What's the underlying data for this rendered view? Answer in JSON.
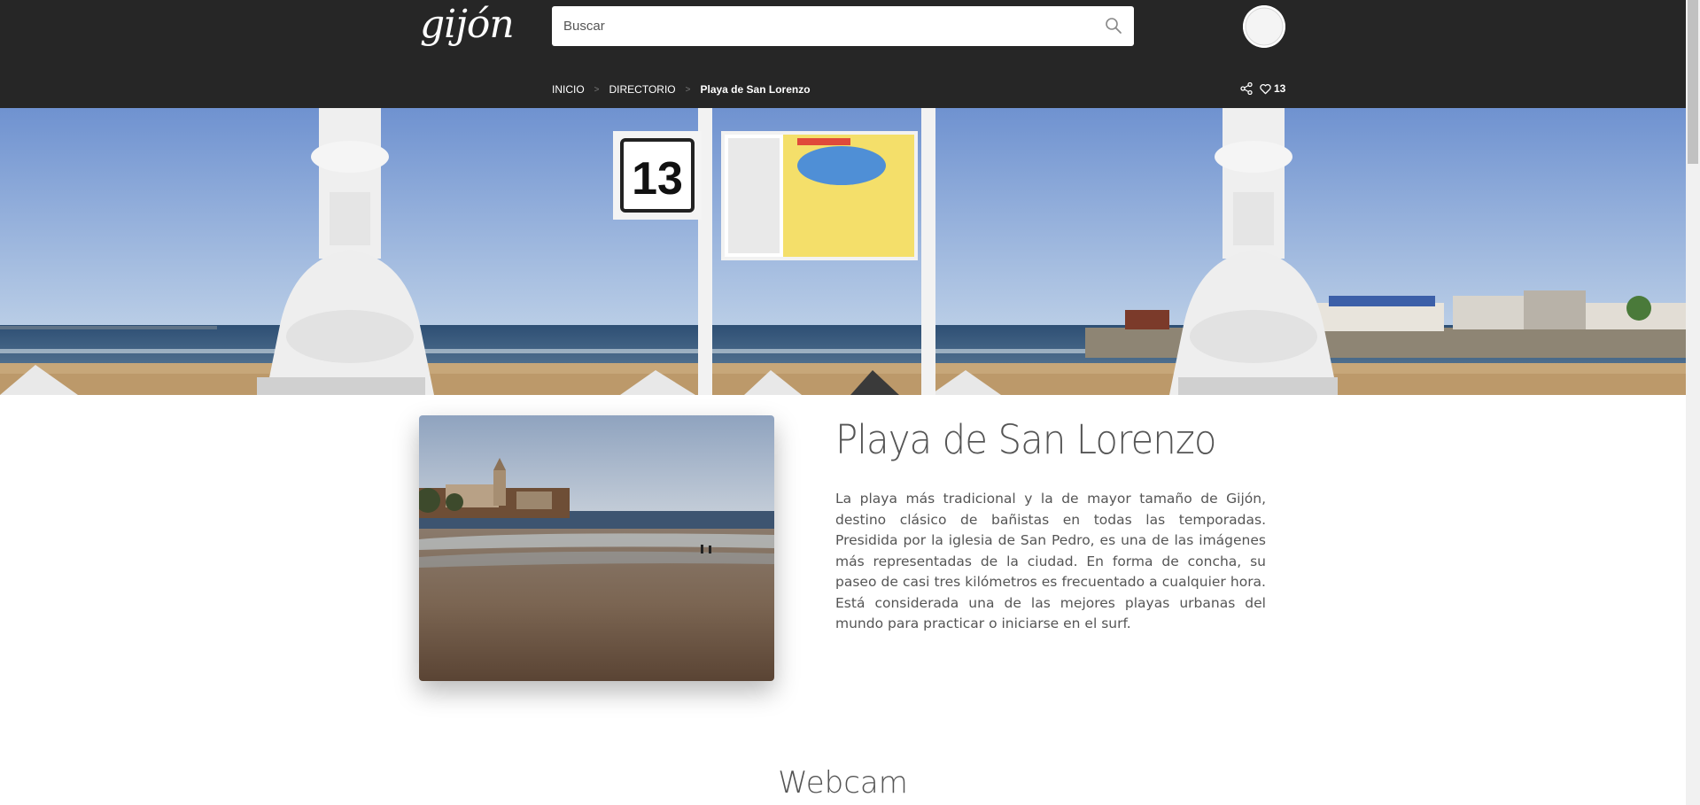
{
  "header": {
    "logo_text": "gijón",
    "search": {
      "placeholder": "Buscar"
    },
    "breadcrumb": [
      "INICIO",
      "DIRECTORIO",
      "Playa de San Lorenzo"
    ],
    "likes_count": "13"
  },
  "hero": {
    "sign_number": "13"
  },
  "main": {
    "title": "Playa de San Lorenzo",
    "description": "La playa más tradicional y la de mayor tamaño de Gijón, destino clásico de bañistas en todas las temporadas. Presidida por la iglesia de San Pedro, es una de las imágenes más representadas de la ciudad. En forma de concha, su paseo de casi tres kilómetros es frecuentado a cualquier hora. Está considerada una de las mejores playas urbanas del mundo para practicar o iniciarse en el surf.",
    "next_section_title": "Webcam"
  },
  "icons": [
    "search-icon",
    "share-icon",
    "heart-icon"
  ],
  "colors": {
    "header_bg": "#262626",
    "text": "#555555",
    "sky": "#7fa0d6",
    "sea": "#33557a",
    "sand": "#c9a878"
  }
}
